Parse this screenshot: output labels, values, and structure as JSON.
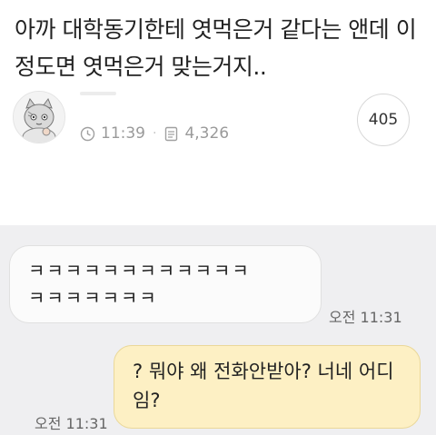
{
  "post": {
    "title": "아까 대학동기한테 엿먹은거 같다는 앤데 이정도면 엿먹은거 맞는거지..",
    "time": "11:39",
    "views": "4,326",
    "comment_count": "405"
  },
  "chat": {
    "received": {
      "line1": "ㅋㅋㅋㅋㅋㅋㅋㅋㅋㅋㅋㅋ",
      "line2": "ㅋㅋㅋㅋㅋㅋㅋ",
      "time": "오전 11:31"
    },
    "sent": {
      "text": "? 뭐야 왜 전화안받아? 너네 어디임?",
      "time": "오전 11:31"
    }
  }
}
